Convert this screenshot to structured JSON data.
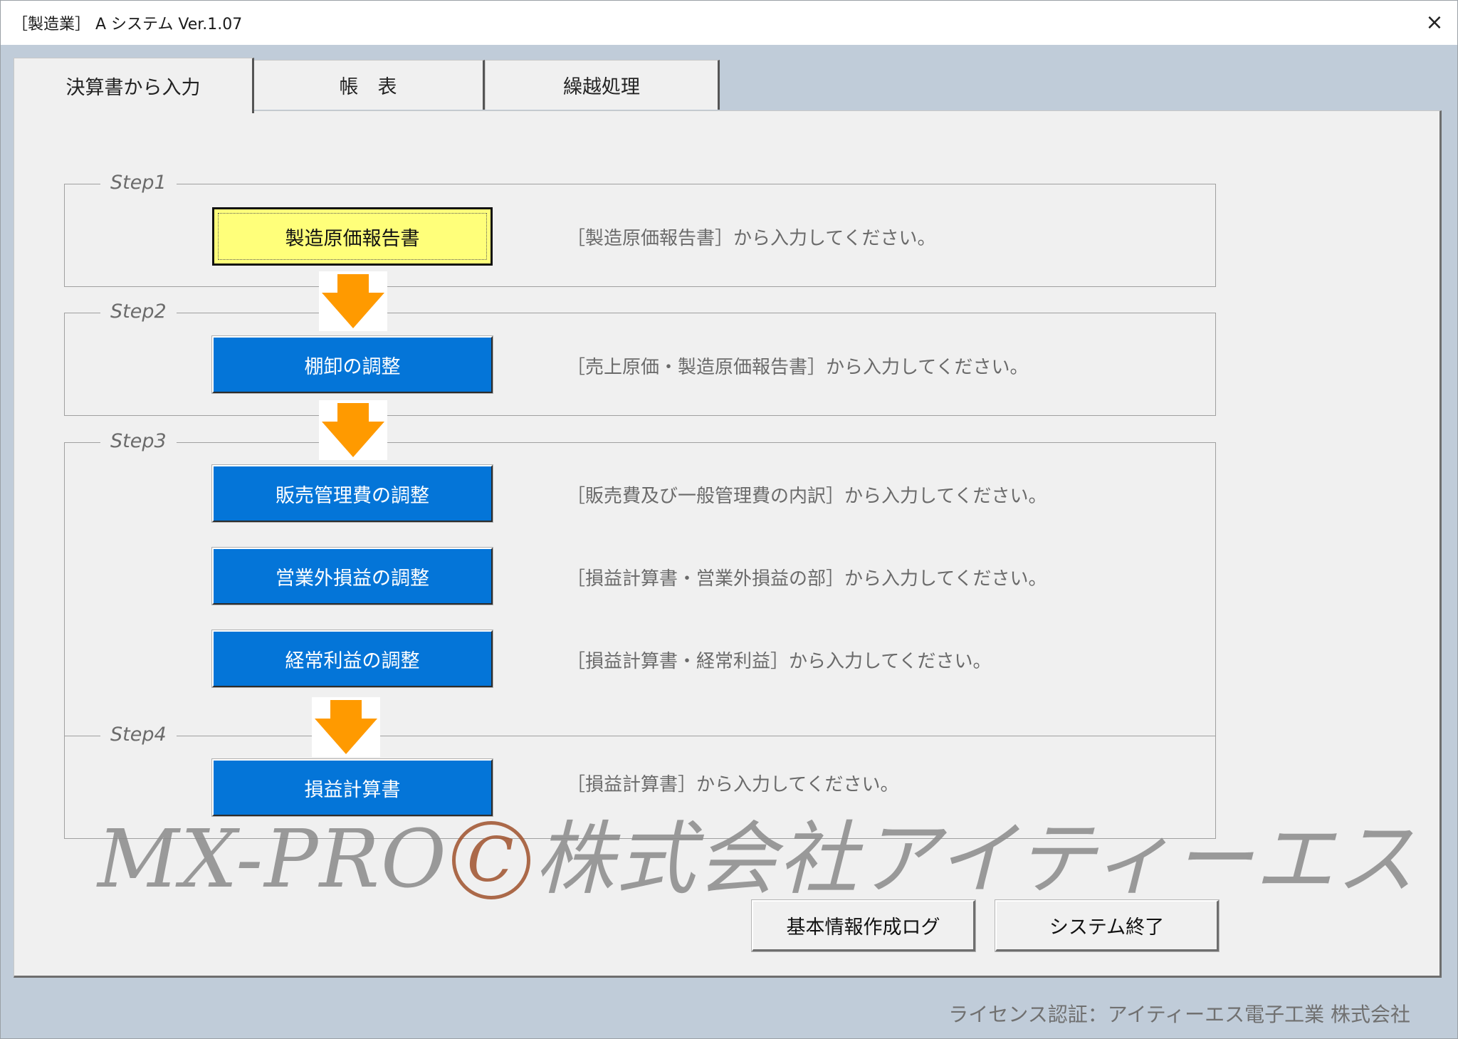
{
  "window": {
    "title": "［製造業］ A システム Ver.1.07",
    "close_icon": "×"
  },
  "tabs": [
    {
      "label": "決算書から入力",
      "active": true
    },
    {
      "label": "帳　表",
      "active": false
    },
    {
      "label": "繰越処理",
      "active": false
    }
  ],
  "steps": [
    {
      "label": "Step1"
    },
    {
      "label": "Step2"
    },
    {
      "label": "Step3"
    },
    {
      "label": "Step4"
    }
  ],
  "actions": [
    {
      "label": "製造原価報告書",
      "hint": "［製造原価報告書］から入力してください。"
    },
    {
      "label": "棚卸の調整",
      "hint": "［売上原価・製造原価報告書］から入力してください。"
    },
    {
      "label": "販売管理費の調整",
      "hint": "［販売費及び一般管理費の内訳］から入力してください。"
    },
    {
      "label": "営業外損益の調整",
      "hint": "［損益計算書・営業外損益の部］から入力してください。"
    },
    {
      "label": "経常利益の調整",
      "hint": "［損益計算書・経常利益］から入力してください。"
    },
    {
      "label": "損益計算書",
      "hint": "［損益計算書］から入力してください。"
    }
  ],
  "footer_buttons": {
    "log": "基本情報作成ログ",
    "exit": "システム終了"
  },
  "watermark": {
    "left": "MX-PRO",
    "copyright": "C",
    "right": "株式会社アイティーエス"
  },
  "license": "ライセンス認証：アイティーエス電子工業 株式会社",
  "colors": {
    "accent_blue": "#0475d8",
    "highlight_yellow": "#ffff7a",
    "arrow_orange": "#ff9a00",
    "window_bg": "#c0ccd9"
  }
}
